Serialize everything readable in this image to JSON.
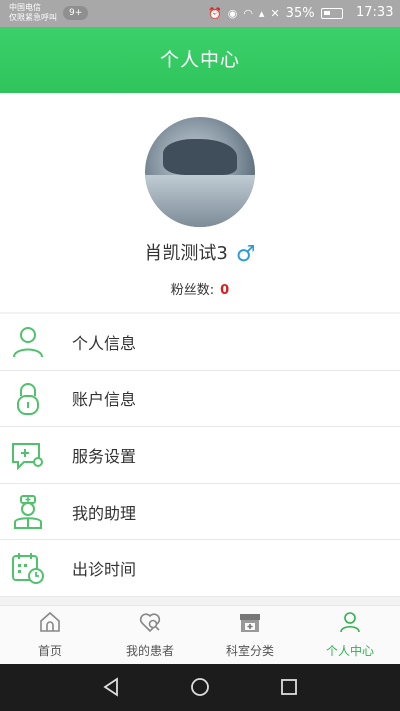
{
  "status_bar": {
    "carrier_line1": "中国电信",
    "carrier_line2": "仅限紧急呼叫",
    "badge": "9+",
    "battery": "35%",
    "time": "17:33"
  },
  "header": {
    "title": "个人中心"
  },
  "profile": {
    "name": "肖凯测试3",
    "gender_symbol": "♂",
    "fans_label": "粉丝数:",
    "fans_count": "0"
  },
  "menu": [
    {
      "label": "个人信息",
      "icon": "person-icon"
    },
    {
      "label": "账户信息",
      "icon": "lock-icon"
    },
    {
      "label": "服务设置",
      "icon": "service-settings-icon"
    },
    {
      "label": "我的助理",
      "icon": "nurse-icon"
    },
    {
      "label": "出诊时间",
      "icon": "calendar-clock-icon"
    }
  ],
  "tabs": [
    {
      "label": "首页",
      "icon": "home-icon",
      "active": false
    },
    {
      "label": "我的患者",
      "icon": "patients-icon",
      "active": false
    },
    {
      "label": "科室分类",
      "icon": "department-icon",
      "active": false
    },
    {
      "label": "个人中心",
      "icon": "profile-icon",
      "active": true
    }
  ],
  "colors": {
    "brand_green": "#2fc45c",
    "active_tab": "#2fb24f",
    "fans_count": "#d61f1f",
    "gender_icon": "#2d9bd8"
  }
}
